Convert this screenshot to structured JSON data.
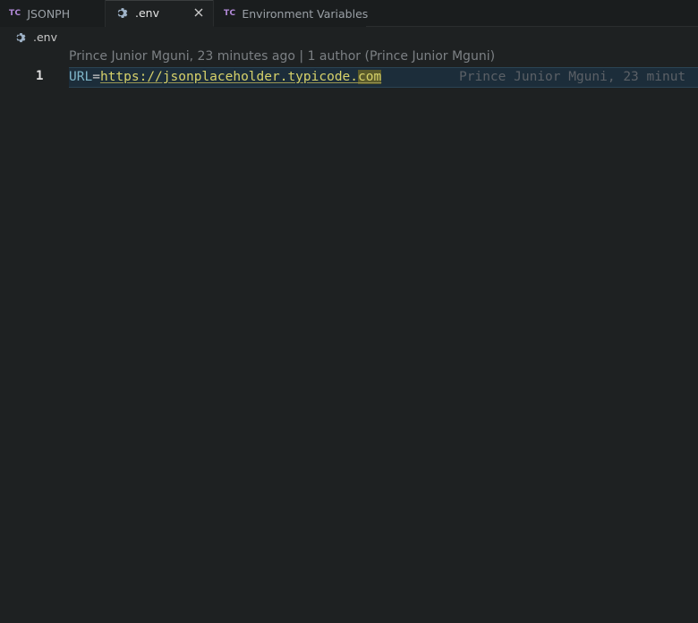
{
  "tabs": [
    {
      "icon": "TC",
      "label": "JSONPH",
      "active": false
    },
    {
      "icon": "gear-icon",
      "label": ".env",
      "active": true,
      "close_glyph": "×"
    },
    {
      "icon": "TC",
      "label": "Environment Variables",
      "active": false
    }
  ],
  "breadcrumb": {
    "icon": "gear-icon",
    "label": ".env"
  },
  "editor": {
    "codelens": {
      "author_time": "Prince Junior Mguni, 23 minutes ago",
      "separator": "|",
      "authors": "1 author (Prince Junior Mguni)"
    },
    "lines": [
      {
        "number": "1",
        "key": "URL",
        "equals": "=",
        "value_main": "https://jsonplaceholder.typicode.",
        "value_highlight": "com",
        "blame": "Prince Junior Mguni, 23 minut"
      }
    ]
  },
  "colors": {
    "background": "#1e2122",
    "tab_icon": "#b38ad9",
    "key": "#7fb6c8",
    "value": "#d7d26a",
    "line_highlight": "#1c2d3a"
  }
}
